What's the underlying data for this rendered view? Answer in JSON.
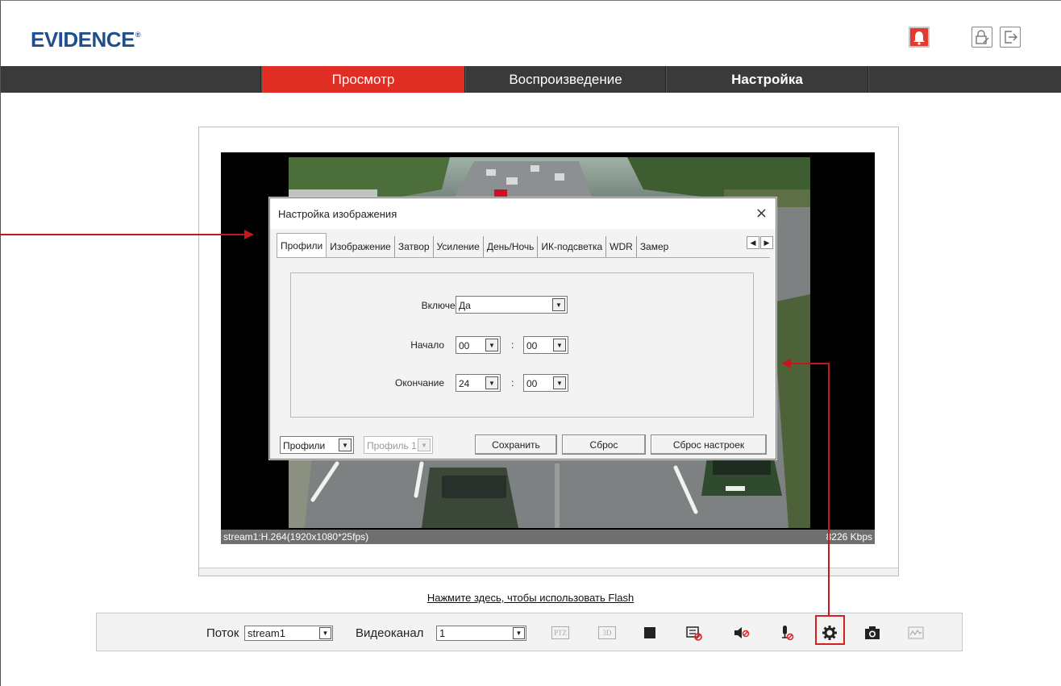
{
  "brand": {
    "logo_text": "EVIDENCE",
    "registered": "®"
  },
  "header_icons": [
    "alarm-icon",
    "lock-icon",
    "logout-icon"
  ],
  "nav": {
    "tabs": [
      {
        "label": "Просмотр",
        "active": true
      },
      {
        "label": "Воспроизведение",
        "active": false
      },
      {
        "label": "Настройка",
        "active": false
      }
    ]
  },
  "video": {
    "stream_info": "stream1:H.264(1920x1080*25fps)",
    "bitrate": "8226 Kbps"
  },
  "dialog": {
    "title": "Настройка изображения",
    "close": "×",
    "tabs": [
      "Профили",
      "Изображение",
      "Затвор",
      "Усиление",
      "День/Ночь",
      "ИК-подсветка",
      "WDR",
      "Замер"
    ],
    "active_tab": "Профили",
    "fields": {
      "enabled_label": "Включено",
      "enabled_value": "Да",
      "start_label": "Начало",
      "start_hour": "00",
      "start_minute": "00",
      "end_label": "Окончание",
      "end_hour": "24",
      "end_minute": "00",
      "separator": ":"
    },
    "footer": {
      "profiles_select": "Профили",
      "profile_select": "Профиль 1",
      "save_label": "Сохранить",
      "reset_label": "Сброс",
      "reset_settings_label": "Сброс настроек"
    }
  },
  "flash_link": "Нажмите здесь, чтобы использовать Flash",
  "toolbar": {
    "stream_label": "Поток",
    "stream_value": "stream1",
    "channel_label": "Видеоканал",
    "channel_value": "1",
    "ptz_label": "PTZ",
    "threed_label": "3D",
    "icons": [
      "ptz-icon",
      "3d-icon",
      "stop-icon",
      "osd-icon",
      "mute-icon",
      "mic-icon",
      "settings-icon",
      "snapshot-icon",
      "stats-icon"
    ]
  },
  "colors": {
    "accent": "#e12e24",
    "navbar": "#3a3a3a",
    "logo": "#1f4e8e",
    "callout": "#c4161c"
  }
}
